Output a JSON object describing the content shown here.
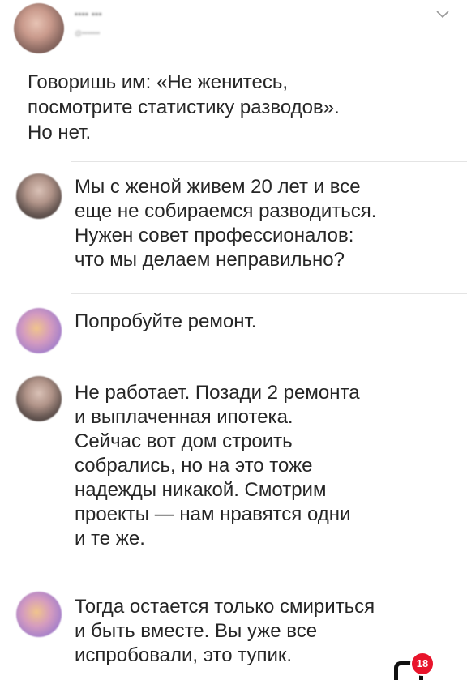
{
  "post": {
    "author_name": "•••• •••",
    "author_handle": "@•••••••",
    "lines": [
      "Говоришь им: «Не женитесь,",
      "посмотрите статистику разводов».",
      "Но нет."
    ]
  },
  "replies": [
    {
      "lines": [
        "Мы с женой живем 20 лет и все",
        "еще не собираемся разводиться.",
        "Нужен совет профессионалов:",
        "что мы делаем неправильно?"
      ]
    },
    {
      "lines": [
        "Попробуйте ремонт."
      ]
    },
    {
      "lines": [
        "Не работает. Позади 2 ремонта",
        "и выплаченная ипотека.",
        "Сейчас вот дом строить",
        "собрались, но на это тоже",
        "надежды никакой. Смотрим",
        "проекты — нам нравятся одни",
        "и те же."
      ]
    },
    {
      "lines": [
        "Тогда остается только смириться",
        "и быть вместе. Вы уже все",
        "испробовали, это тупик."
      ]
    }
  ],
  "watermark": {
    "badge_text": "18",
    "badge_color": "#e8142b"
  },
  "icons": {
    "menu": "chevron-down-icon"
  }
}
